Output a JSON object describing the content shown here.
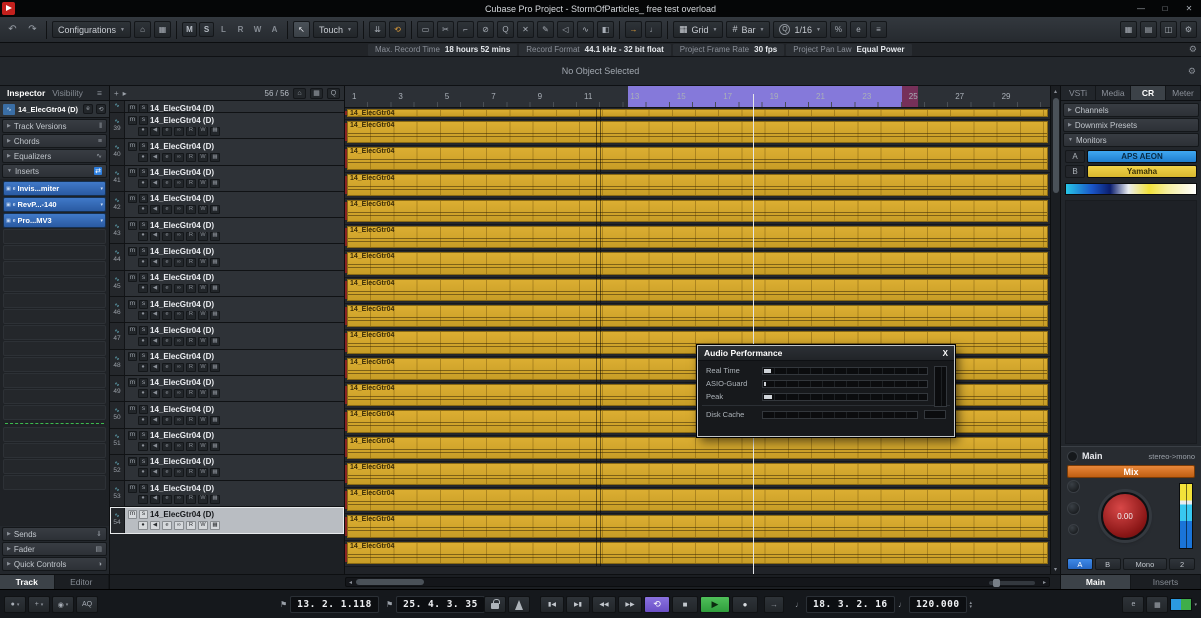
{
  "titlebar": {
    "title": "Cubase Pro Project - StormOfParticles_ free test overload"
  },
  "toolbar": {
    "configurations_label": "Configurations",
    "state_buttons": [
      "M",
      "S",
      "L",
      "R",
      "W",
      "A"
    ],
    "automation_mode": "Touch",
    "grid_type": "Grid",
    "grid_value": "Bar",
    "quantize_prefix": "Q",
    "quantize_value": "1/16"
  },
  "info_line": [
    {
      "label": "Max. Record Time",
      "value": "18 hours 52 mins"
    },
    {
      "label": "Record Format",
      "value": "44.1 kHz - 32 bit float"
    },
    {
      "label": "Project Frame Rate",
      "value": "30 fps"
    },
    {
      "label": "Project Pan Law",
      "value": "Equal Power"
    }
  ],
  "status_line": "No Object Selected",
  "inspector": {
    "tabs": [
      {
        "label": "Inspector",
        "active": true
      },
      {
        "label": "Visibility",
        "active": false
      }
    ],
    "track_name": "14_ElecGtr04 (D)",
    "sections": [
      {
        "label": "Track Versions",
        "icon": "‖",
        "active": false
      },
      {
        "label": "Chords",
        "icon": "≡",
        "active": false
      },
      {
        "label": "Equalizers",
        "icon": "∿",
        "active": false
      },
      {
        "label": "Inserts",
        "icon": "⇄",
        "active": true
      }
    ],
    "inserts": [
      "Invis...miter",
      "RevP...-140",
      "Pro...MV3"
    ],
    "empty_slots_before": 12,
    "empty_slots_after": 4,
    "lower_sections": [
      {
        "label": "Sends",
        "icon": "⇓"
      },
      {
        "label": "Fader",
        "icon": "▤"
      },
      {
        "label": "Quick Controls",
        "icon": "◑"
      }
    ]
  },
  "tracklist": {
    "count": "56 / 56",
    "track_name": "14_ElecGtr04 (D)",
    "numbers": [
      39,
      40,
      41,
      42,
      43,
      44,
      45,
      46,
      47,
      48,
      49,
      50,
      51,
      52,
      53,
      54
    ],
    "selected_number": 54
  },
  "arrange": {
    "ruler_bars": [
      1,
      3,
      5,
      7,
      9,
      11,
      13,
      15,
      17,
      19,
      21,
      23,
      25,
      27,
      29
    ],
    "clip_label": "14_ElecGtr04",
    "lane_count": 18
  },
  "audio_performance": {
    "title": "Audio Performance",
    "close_label": "X",
    "rows": [
      {
        "label": "Real Time",
        "level": 4
      },
      {
        "label": "ASIO-Guard",
        "level": 1
      },
      {
        "label": "Peak",
        "level": 5
      }
    ],
    "disk_cache_label": "Disk Cache",
    "disk_cache_level": 0
  },
  "right_zone": {
    "tabs": [
      {
        "label": "VSTi",
        "active": false
      },
      {
        "label": "Media",
        "active": false
      },
      {
        "label": "CR",
        "active": true
      },
      {
        "label": "Meter",
        "active": false
      }
    ],
    "sections": [
      "Channels",
      "Downmix Presets",
      "Monitors"
    ],
    "monitors": [
      {
        "key": "A",
        "name": "APS AEON",
        "color": "blue"
      },
      {
        "key": "B",
        "name": "Yamaha",
        "color": "yellow"
      }
    ],
    "main_label": "Main",
    "routing": "stereo->mono",
    "mix_label": "Mix",
    "knob_value": "0.00",
    "bottom_buttons": [
      "A",
      "B",
      "Mono",
      "2"
    ],
    "bottom_tabs": [
      {
        "label": "Main",
        "active": true
      },
      {
        "label": "Inserts",
        "active": false
      }
    ]
  },
  "bottom_tabs_left": [
    {
      "label": "Track",
      "active": true
    },
    {
      "label": "Editor",
      "active": false
    }
  ],
  "transport": {
    "aq_label": "AQ",
    "primary_position": "13. 2. 1.118",
    "secondary_position": "25. 4. 3. 35",
    "locator_position": "18. 3. 2. 16",
    "tempo": "120.000"
  },
  "colors": {
    "clip_yellow": "#d2a42c",
    "cycle_selection_purple": "#8d80e8",
    "monitor_a_blue": "#2e9ae8",
    "monitor_b_yellow": "#e8c93a",
    "mix_button_orange": "#d97a28",
    "play_green": "#3fae4a",
    "cycle_purple": "#7a5fd8",
    "knob_red": "#b22222"
  },
  "icons": {
    "undo": "↶",
    "redo": "↷",
    "caret_down": "▼",
    "caret_small": "▾",
    "caret_right": "▸",
    "home": "⌂",
    "grid_view": "▦",
    "list_view": "▤",
    "panel_view": "◫",
    "gear": "⚙",
    "menu": "≡",
    "hash": "#",
    "window_min": "—",
    "window_max": "□",
    "window_close": "✕",
    "tool_select": "↖",
    "tool_range": "▭",
    "tool_split": "✂",
    "tool_glue": "⌐",
    "tool_erase": "⊘",
    "tool_zoom": "Q",
    "tool_mute": "✕",
    "tool_draw": "✎",
    "tool_monitor": "◁",
    "tool_line": "∿",
    "tool_color": "◧",
    "autoscroll": "⇊",
    "loop": "⟲",
    "arrow_orange": "→",
    "percent": "%",
    "note": "♩",
    "plus": "+",
    "folder": "▸",
    "magnifier": "Q",
    "edit_e": "e",
    "mute_label": "m",
    "solo_label": "s",
    "record_dot": "●",
    "monitor_speaker": "◀",
    "freeze": "∞",
    "read_label": "R",
    "write_label": "W",
    "lanes": "▦",
    "wave": "∿",
    "flag": "⚑",
    "t_prev": "▮◀",
    "t_next": "▶▮",
    "t_rew": "◀◀",
    "t_fwd": "▶▶",
    "t_cycle": "⟲",
    "t_stop": "■",
    "t_play": "▶",
    "t_rec": "●",
    "t_jump": "→",
    "crosshair": "+",
    "circle_dot": "◉",
    "scroll_left": "◂",
    "scroll_right": "▸",
    "scroll_up": "▴",
    "scroll_down": "▾",
    "spin_up": "▴",
    "spin_down": "▾"
  }
}
